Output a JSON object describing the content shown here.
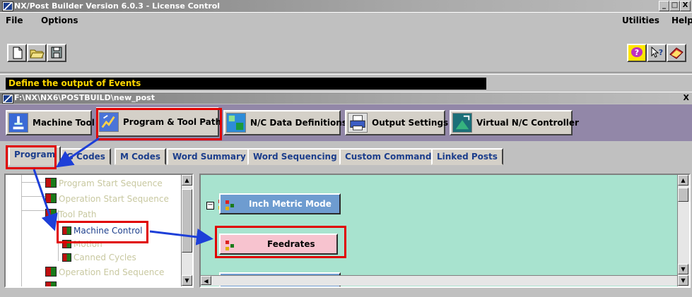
{
  "app": {
    "title": "NX/Post Builder Version 6.0.3 - License Control",
    "window_buttons": [
      "_",
      "□",
      "X"
    ]
  },
  "menu": {
    "file": "File",
    "options": "Options",
    "utilities": "Utilities",
    "help": "Help"
  },
  "toolbar": {
    "new": "new-file-icon",
    "open": "open-folder-icon",
    "save": "save-disk-icon",
    "help_icons": [
      "balloon-help-icon",
      "context-help-icon",
      "manual-icon"
    ]
  },
  "status": {
    "message": "Define the output of Events"
  },
  "child_window": {
    "title": "F:\\NX\\NX6\\POSTBUILD\\new_post",
    "close": "X"
  },
  "main_tabs": [
    {
      "label": "Machine Tool"
    },
    {
      "label": "Program & Tool Path"
    },
    {
      "label": "N/C Data Definitions"
    },
    {
      "label": "Output Settings"
    },
    {
      "label": "Virtual N/C Controller"
    }
  ],
  "main_tab_active": "Program & Tool Path",
  "sub_tabs": [
    {
      "label": "Program"
    },
    {
      "label": "G Codes"
    },
    {
      "label": "M Codes"
    },
    {
      "label": "Word Summary"
    },
    {
      "label": "Word Sequencing"
    },
    {
      "label": "Custom Command"
    },
    {
      "label": "Linked Posts"
    }
  ],
  "sub_tab_active": "Program",
  "tree": [
    {
      "label": "Program Start Sequence"
    },
    {
      "label": "Operation Start Sequence"
    },
    {
      "label": "Tool Path"
    },
    {
      "label": "Machine Control"
    },
    {
      "label": "Motion"
    },
    {
      "label": "Canned Cycles"
    },
    {
      "label": "Operation End Sequence"
    }
  ],
  "tree_selected": "Machine Control",
  "blocks": [
    {
      "label": "Inch Metric Mode"
    },
    {
      "label": "Feedrates"
    }
  ],
  "colors": {
    "accent_red": "#e00000",
    "arrow_blue": "#1d3fd8",
    "panel_green": "#a8e3cf",
    "block_blue": "#6e9cd0",
    "block_pink": "#f7c3cf",
    "status_text": "#ffd700"
  }
}
